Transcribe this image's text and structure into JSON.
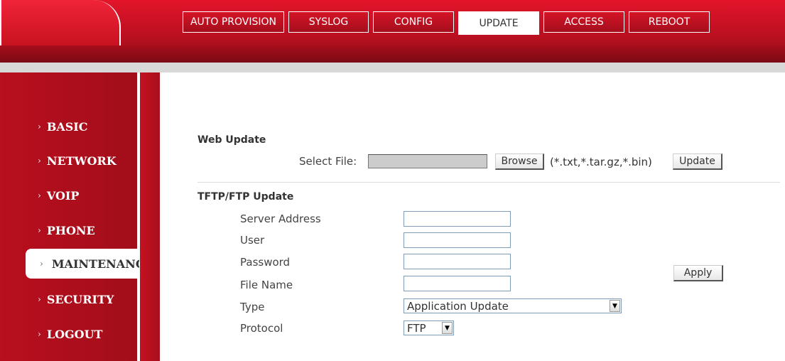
{
  "header": {
    "tabs": [
      {
        "label": "AUTO PROVISION",
        "active": false
      },
      {
        "label": "SYSLOG",
        "active": false
      },
      {
        "label": "CONFIG",
        "active": false
      },
      {
        "label": "UPDATE",
        "active": true
      },
      {
        "label": "ACCESS",
        "active": false
      },
      {
        "label": "REBOOT",
        "active": false
      }
    ]
  },
  "sidebar": {
    "items": [
      {
        "label": "BASIC",
        "active": false
      },
      {
        "label": "NETWORK",
        "active": false
      },
      {
        "label": "VOIP",
        "active": false
      },
      {
        "label": "PHONE",
        "active": false
      },
      {
        "label": "MAINTENANCE",
        "active": true
      },
      {
        "label": "SECURITY",
        "active": false
      },
      {
        "label": "LOGOUT",
        "active": false
      }
    ]
  },
  "web_update": {
    "title": "Web Update",
    "select_file_label": "Select File:",
    "file_value": "",
    "browse_label": "Browse",
    "hint": "(*.txt,*.tar.gz,*.bin)",
    "update_label": "Update"
  },
  "tftp_update": {
    "title": "TFTP/FTP Update",
    "server_address_label": "Server Address",
    "server_address_value": "",
    "user_label": "User",
    "user_value": "",
    "password_label": "Password",
    "password_value": "",
    "file_name_label": "File Name",
    "file_name_value": "",
    "type_label": "Type",
    "type_value": "Application Update",
    "protocol_label": "Protocol",
    "protocol_value": "FTP",
    "apply_label": "Apply"
  },
  "colors": {
    "brand_red": "#b90f1e",
    "header_red": "#e3142a"
  },
  "icons": {
    "dropdown": "chevron-down-icon",
    "nav_bullet": "chevron-right-icon"
  }
}
